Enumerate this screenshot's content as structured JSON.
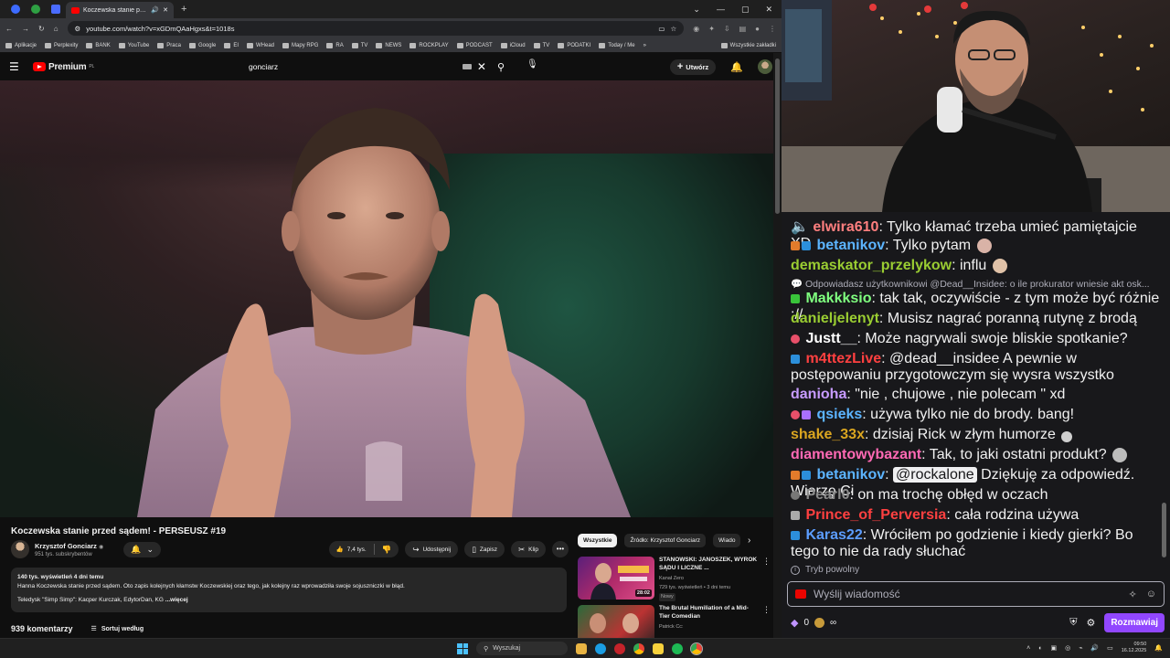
{
  "browser": {
    "tab_title": "Koczewska stanie przed sąd...",
    "url": "youtube.com/watch?v=xGDmQAaHgxs&t=1018s",
    "bookmarks": [
      "Aplikacje",
      "Perplexity",
      "BANK",
      "YouTube",
      "Praca",
      "Google",
      "EI",
      "WHead",
      "Mapy RPG",
      "RA",
      "TV",
      "NEWS",
      "ROCKPLAY",
      "PODCAST",
      "iCloud",
      "TV",
      "PODATKI",
      "Today / Me"
    ],
    "all_bookmarks": "Wszystkie zakładki"
  },
  "youtube": {
    "logo_text": "Premium",
    "logo_region": "PL",
    "search_query": "gonciarz",
    "create_label": "Utwórz",
    "video_title": "Koczewska stanie przed sądem! - PERSEUSZ #19",
    "channel_name": "Krzysztof Gonciarz",
    "channel_subs": "951 tys. subskrybentów",
    "likes": "7,4 tys.",
    "share_label": "Udostępnij",
    "save_label": "Zapisz",
    "clip_label": "Klip",
    "desc_stats": "140 tys. wyświetleń  4 dni temu",
    "desc_line1": "Hanna Koczewska stanie przed sądem. Oto zapis kolejnych kłamstw Koczewskiej oraz tego, jak kolejny raz wprowadziła swoje sojuszniczki w błąd.",
    "desc_line2": "Teledysk \"Simp Simp\": Kacper Kurczak, EdytorDan, KG",
    "desc_more": "...więcej",
    "comments_count": "939 komentarzy",
    "sort_label": "Sortuj według",
    "chips": [
      "Wszystkie",
      "Źródło: Krzysztof Gonciarz",
      "Wiado"
    ],
    "related": [
      {
        "title": "STANOWSKI: JANOSZEK, WYROK SĄDU I LICZNE ...",
        "channel": "Kanał Zero",
        "stats": "729 tys. wyświetleń • 3 dni temu",
        "badge": "Nowy",
        "duration": "28:02"
      },
      {
        "title": "The Brutal Humiliation of a Mid-Tier Comedian",
        "channel": "Patrick Cc:",
        "stats": "",
        "badge": "",
        "duration": ""
      }
    ]
  },
  "chat": {
    "messages": [
      {
        "user": "elwira610",
        "color": "#ff7f7f",
        "text": "Tylko kłamać trzeba umieć pamiętajcie XD"
      },
      {
        "user": "betanikov",
        "color": "#5cb4ff",
        "text": "Tylko pytam"
      },
      {
        "user": "demaskator_przelykow",
        "color": "#9acd32",
        "text": "influ"
      },
      {
        "user": "Makkksio",
        "color": "#7fff7f",
        "text": "tak tak, oczywiście - z tym może być różnie ://"
      },
      {
        "user": "danieljelenyt",
        "color": "#9acd32",
        "text": "Musisz nagrać poranną rutynę z brodą"
      },
      {
        "user": "Justt__",
        "color": "#ffffff",
        "text": "Może nagrywali swoje bliskie spotkanie?"
      },
      {
        "user": "m4ttezLive",
        "color": "#ff4040",
        "text": "@dead__insidee A pewnie w postępowaniu przygotowczym się wysra wszystko"
      },
      {
        "user": "danioha",
        "color": "#c79bff",
        "text": "\"nie , chujowe , nie polecam \" xd"
      },
      {
        "user": "qsieks",
        "color": "#5cb4ff",
        "text": "używa tylko nie do brody. bang!"
      },
      {
        "user": "shake_33x",
        "color": "#daa520",
        "text": "dzisiaj Rick w złym humorze"
      },
      {
        "user": "diamentowybazant",
        "color": "#ff69b4",
        "text": "Tak, to jaki ostatni produkt?"
      },
      {
        "user": "betanikov",
        "color": "#5cb4ff",
        "mention": "@rockalone",
        "text": "Dziękuję za odpowiedź. Wierzę Ci"
      },
      {
        "user": "Pearl0",
        "color": "#8a8a8a",
        "text": "on ma trochę obłęd w oczach"
      },
      {
        "user": "Prince_of_Perversia",
        "color": "#ff4040",
        "text": "cała rodzina używa"
      },
      {
        "user": "Karas22",
        "color": "#5c9dff",
        "text": "Wróciłem po godzienie i kiedy gierki? Bo tego to nie da rady słuchać"
      }
    ],
    "reply_text": "Odpowiadasz użytkownikowi @Dead__Insidee: o ile prokurator wniesie akt osk...",
    "slow_mode": "Tryb powolny",
    "input_placeholder": "Wyślij wiadomość",
    "points": "0",
    "infinity": "∞",
    "chat_button": "Rozmawiaj"
  },
  "taskbar": {
    "search_label": "Wyszukaj",
    "time": "09:50",
    "date": "16.12.2025"
  },
  "colors": {
    "youtube_red": "#ff0000",
    "twitch_purple": "#9147ff",
    "bg_dark": "#0f0f0f"
  }
}
